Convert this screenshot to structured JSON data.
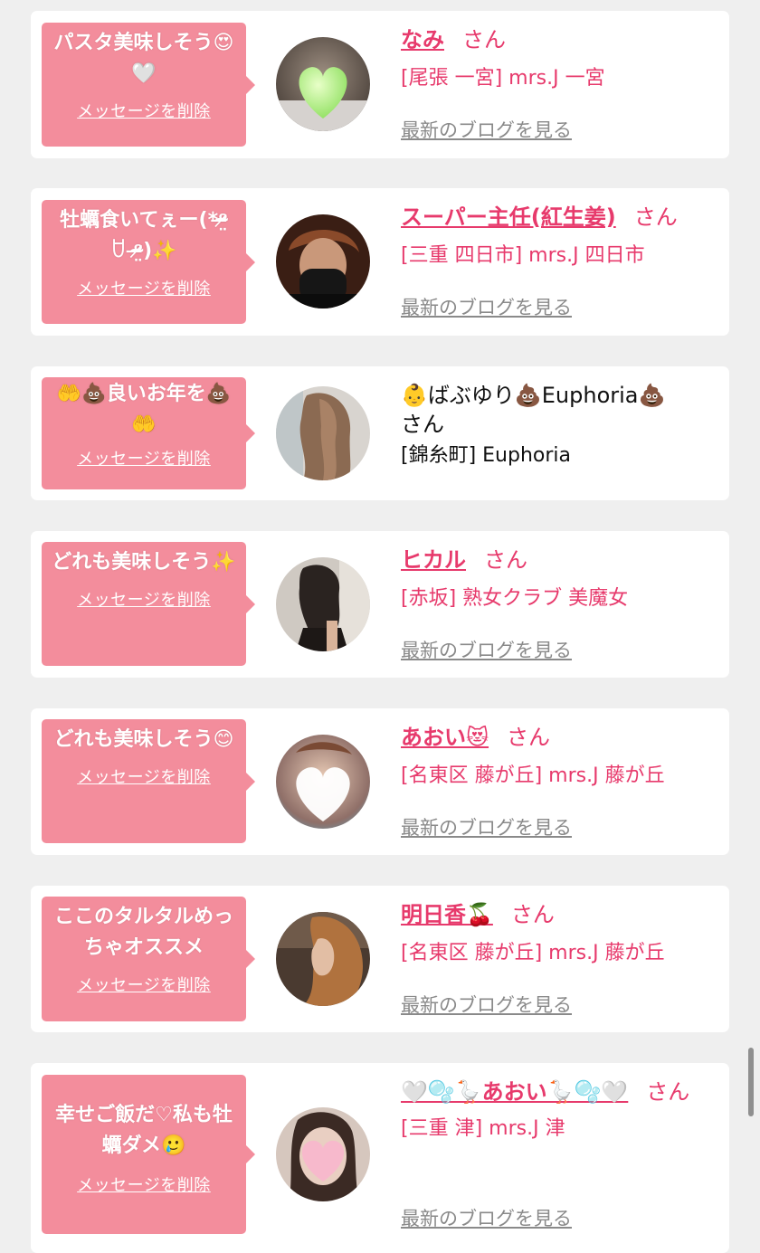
{
  "delete_label": "メッセージを削除",
  "blog_label": "最新のブログを見る",
  "san": "さん",
  "colors": {
    "accent": "#e73a6c",
    "bubble": "#f38d9c",
    "card": "#ffffff",
    "background": "#efefef"
  },
  "items": [
    {
      "message": "パスタ美味しそう😍🤍",
      "name": "なみ",
      "shop": "[尾張 一宮] mrs.J 一宮",
      "avatar": "avatar-heart-photo"
    },
    {
      "message": "牡蠣食いてぇー(*ᵒ̴̶̷̤ ꇴ ᵒ̴̶̷̤)✨",
      "name": "スーパー主任(紅生姜)",
      "shop": "[三重 四日市] mrs.J 四日市",
      "avatar": "avatar-man-photo"
    },
    {
      "message": "🤲💩良いお年を💩🤲",
      "name": "👶ばぶゆり💩Euphoria💩",
      "shop": "[錦糸町] Euphoria",
      "avatar": "avatar-hair-photo"
    },
    {
      "message": "どれも美味しそう✨",
      "name": "ヒカル",
      "shop": "[赤坂] 熟女クラブ 美魔女",
      "avatar": "avatar-dress-photo"
    },
    {
      "message": "どれも美味しそう😊",
      "name": "あおい😻",
      "shop": "[名東区 藤が丘] mrs.J 藤が丘",
      "avatar": "avatar-heart-blur-photo"
    },
    {
      "message": "ここのタルタルめっちゃオススメ",
      "name": "明日香🍒",
      "shop": "[名東区 藤が丘] mrs.J 藤が丘",
      "avatar": "avatar-side-profile-photo"
    },
    {
      "message": "幸せご飯だ♡私も牡蠣ダメ🥲",
      "name": "🤍🫧🪿あおい🪿🫧🤍",
      "shop": "[三重 津] mrs.J 津",
      "avatar": "avatar-pink-heart-photo"
    }
  ]
}
